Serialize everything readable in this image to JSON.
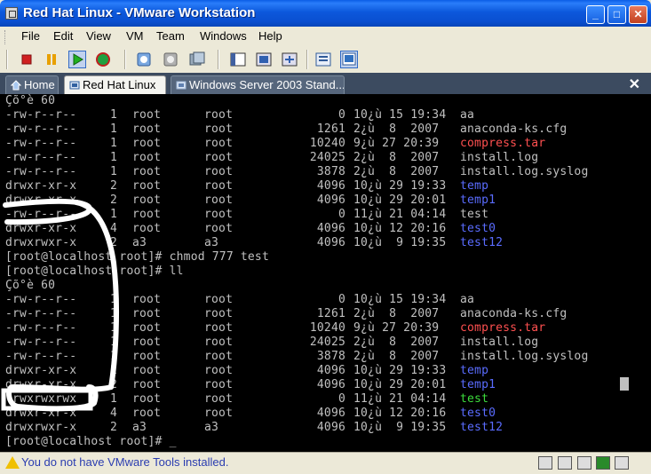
{
  "window": {
    "title": "Red Hat Linux - VMware Workstation"
  },
  "menu": [
    "File",
    "Edit",
    "View",
    "VM",
    "Team",
    "Windows",
    "Help"
  ],
  "tabs": [
    {
      "label": "Home"
    },
    {
      "label": "Red Hat Linux",
      "active": true
    },
    {
      "label": "Windows Server 2003 Stand..."
    }
  ],
  "toolbar_icons": [
    "stop-icon",
    "pause-icon",
    "play-icon",
    "reset-icon",
    "snapshot-icon",
    "revert-snapshot-icon",
    "snapshot-manager-icon",
    "quick-switch-icon",
    "full-screen-icon",
    "fit-window-icon",
    "summary-view-icon",
    "console-view-icon"
  ],
  "colors": {
    "red_file": "#ff5050",
    "dir": "#5a6cff",
    "exec": "#3cdc3c",
    "text": "#c0c0c0"
  },
  "console_lines": [
    {
      "perm": "Çõ°è 60",
      "links": "",
      "owner": "",
      "group": "",
      "size": "",
      "date": "",
      "name": "",
      "color": "text"
    },
    {
      "perm": "-rw-r--r--",
      "links": "1",
      "owner": "root",
      "group": "root",
      "size": "0",
      "date": "10¿ù 15 19:34",
      "name": "aa",
      "color": "text"
    },
    {
      "perm": "-rw-r--r--",
      "links": "1",
      "owner": "root",
      "group": "root",
      "size": "1261",
      "date": "2¿ù  8  2007",
      "name": "anaconda-ks.cfg",
      "color": "text"
    },
    {
      "perm": "-rw-r--r--",
      "links": "1",
      "owner": "root",
      "group": "root",
      "size": "10240",
      "date": "9¿ù 27 20:39",
      "name": "compress.tar",
      "color": "red_file"
    },
    {
      "perm": "-rw-r--r--",
      "links": "1",
      "owner": "root",
      "group": "root",
      "size": "24025",
      "date": "2¿ù  8  2007",
      "name": "install.log",
      "color": "text"
    },
    {
      "perm": "-rw-r--r--",
      "links": "1",
      "owner": "root",
      "group": "root",
      "size": "3878",
      "date": "2¿ù  8  2007",
      "name": "install.log.syslog",
      "color": "text"
    },
    {
      "perm": "drwxr-xr-x",
      "links": "2",
      "owner": "root",
      "group": "root",
      "size": "4096",
      "date": "10¿ù 29 19:33",
      "name": "temp",
      "color": "dir"
    },
    {
      "perm": "drwxr-xr-x",
      "links": "2",
      "owner": "root",
      "group": "root",
      "size": "4096",
      "date": "10¿ù 29 20:01",
      "name": "temp1",
      "color": "dir"
    },
    {
      "perm": "-rw-r--r--",
      "links": "1",
      "owner": "root",
      "group": "root",
      "size": "0",
      "date": "11¿ù 21 04:14",
      "name": "test",
      "color": "text"
    },
    {
      "perm": "drwxr-xr-x",
      "links": "4",
      "owner": "root",
      "group": "root",
      "size": "4096",
      "date": "10¿ù 12 20:16",
      "name": "test0",
      "color": "dir"
    },
    {
      "perm": "drwxrwxr-x",
      "links": "2",
      "owner": "a3",
      "group": "a3",
      "size": "4096",
      "date": "10¿ù  9 19:35",
      "name": "test12",
      "color": "dir"
    },
    {
      "perm": "[root@localhost root]# chmod 777 test",
      "links": "",
      "owner": "",
      "group": "",
      "size": "",
      "date": "",
      "name": "",
      "color": "text"
    },
    {
      "perm": "[root@localhost root]# ll",
      "links": "",
      "owner": "",
      "group": "",
      "size": "",
      "date": "",
      "name": "",
      "color": "text"
    },
    {
      "perm": "Çõ°è 60",
      "links": "",
      "owner": "",
      "group": "",
      "size": "",
      "date": "",
      "name": "",
      "color": "text"
    },
    {
      "perm": "-rw-r--r--",
      "links": "1",
      "owner": "root",
      "group": "root",
      "size": "0",
      "date": "10¿ù 15 19:34",
      "name": "aa",
      "color": "text"
    },
    {
      "perm": "-rw-r--r--",
      "links": "1",
      "owner": "root",
      "group": "root",
      "size": "1261",
      "date": "2¿ù  8  2007",
      "name": "anaconda-ks.cfg",
      "color": "text"
    },
    {
      "perm": "-rw-r--r--",
      "links": "1",
      "owner": "root",
      "group": "root",
      "size": "10240",
      "date": "9¿ù 27 20:39",
      "name": "compress.tar",
      "color": "red_file"
    },
    {
      "perm": "-rw-r--r--",
      "links": "1",
      "owner": "root",
      "group": "root",
      "size": "24025",
      "date": "2¿ù  8  2007",
      "name": "install.log",
      "color": "text"
    },
    {
      "perm": "-rw-r--r--",
      "links": "1",
      "owner": "root",
      "group": "root",
      "size": "3878",
      "date": "2¿ù  8  2007",
      "name": "install.log.syslog",
      "color": "text"
    },
    {
      "perm": "drwxr-xr-x",
      "links": "2",
      "owner": "root",
      "group": "root",
      "size": "4096",
      "date": "10¿ù 29 19:33",
      "name": "temp",
      "color": "dir"
    },
    {
      "perm": "drwxr-xr-x",
      "links": "2",
      "owner": "root",
      "group": "root",
      "size": "4096",
      "date": "10¿ù 29 20:01",
      "name": "temp1",
      "color": "dir"
    },
    {
      "perm": "-rwxrwxrwx",
      "links": "1",
      "owner": "root",
      "group": "root",
      "size": "0",
      "date": "11¿ù 21 04:14",
      "name": "test",
      "color": "exec"
    },
    {
      "perm": "drwxr-xr-x",
      "links": "4",
      "owner": "root",
      "group": "root",
      "size": "4096",
      "date": "10¿ù 12 20:16",
      "name": "test0",
      "color": "dir"
    },
    {
      "perm": "drwxrwxr-x",
      "links": "2",
      "owner": "a3",
      "group": "a3",
      "size": "4096",
      "date": "10¿ù  9 19:35",
      "name": "test12",
      "color": "dir"
    },
    {
      "perm": "[root@localhost root]# _",
      "links": "",
      "owner": "",
      "group": "",
      "size": "",
      "date": "",
      "name": "",
      "color": "text"
    }
  ],
  "status": {
    "warning": "You do not have VMware Tools installed."
  }
}
